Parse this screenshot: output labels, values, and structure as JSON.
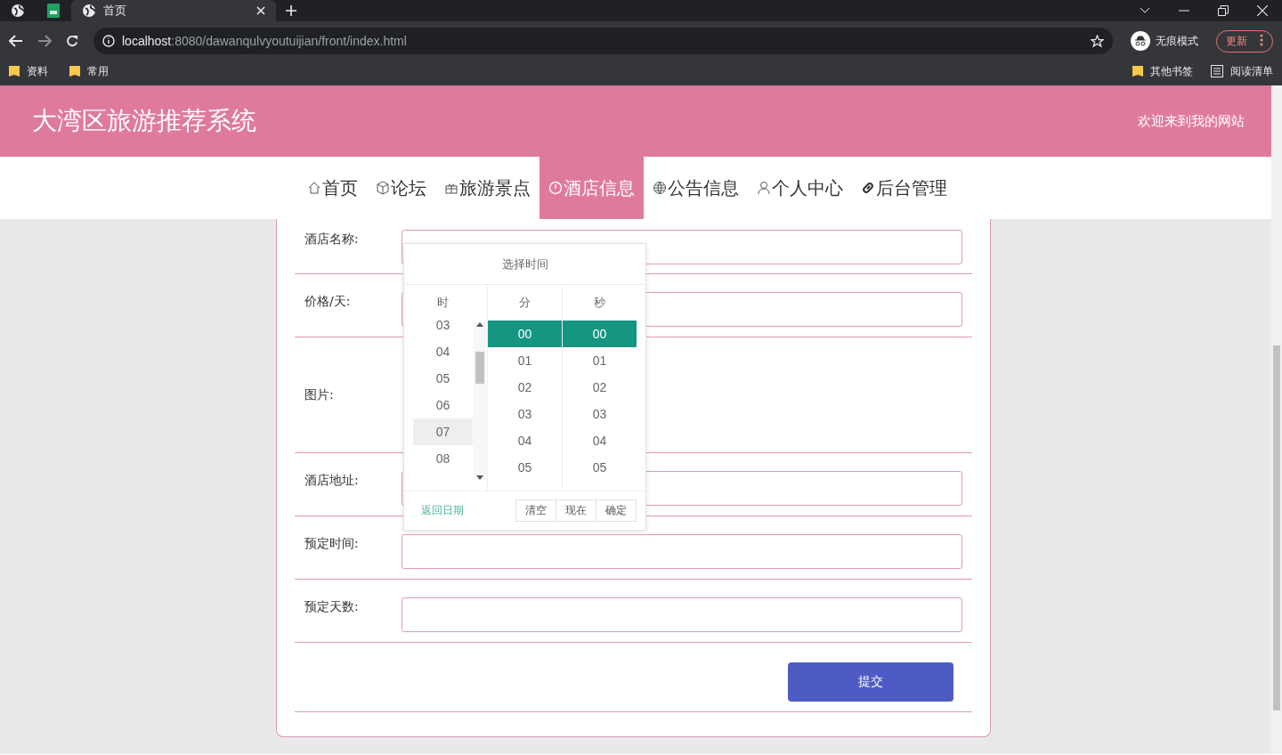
{
  "browser": {
    "tabs": [
      {
        "title": "首页",
        "selected": true
      }
    ],
    "address": {
      "host": "localhost",
      "path": ":8080/dawanqulvyoutuijian/front/index.html"
    },
    "profile": "无痕模式",
    "update_button": "更新",
    "bookmarks": [
      "资料",
      "常用"
    ],
    "other_bookmarks": "其他书签",
    "reading_list": "阅读清单"
  },
  "site": {
    "title": "大湾区旅游推荐系统",
    "welcome": "欢迎来到我的网站"
  },
  "nav": [
    {
      "label": "首页",
      "selected": false
    },
    {
      "label": "论坛",
      "selected": false
    },
    {
      "label": "旅游景点",
      "selected": false
    },
    {
      "label": "酒店信息",
      "selected": true
    },
    {
      "label": "公告信息",
      "selected": false
    },
    {
      "label": "个人中心",
      "selected": false
    },
    {
      "label": "后台管理",
      "selected": false
    }
  ],
  "form": {
    "fields": [
      {
        "label": "酒店名称:",
        "kind": "input"
      },
      {
        "label": "价格/天:",
        "kind": "input"
      },
      {
        "label": "图片:",
        "kind": "image"
      },
      {
        "label": "酒店地址:",
        "kind": "input"
      },
      {
        "label": "预定时间:",
        "kind": "input"
      },
      {
        "label": "预定天数:",
        "kind": "input"
      }
    ],
    "submit": "提交"
  },
  "time_picker": {
    "title": "选择时间",
    "columns": [
      {
        "header": "时",
        "items": [
          {
            "text": "03",
            "selected": false,
            "hovered": false
          },
          {
            "text": "04",
            "selected": false,
            "hovered": false
          },
          {
            "text": "05",
            "selected": false,
            "hovered": false
          },
          {
            "text": "06",
            "selected": false,
            "hovered": false
          },
          {
            "text": "07",
            "selected": false,
            "hovered": true
          },
          {
            "text": "08",
            "selected": false,
            "hovered": false
          }
        ]
      },
      {
        "header": "分",
        "items": [
          {
            "text": "00",
            "selected": true,
            "hovered": false
          },
          {
            "text": "01",
            "selected": false,
            "hovered": false
          },
          {
            "text": "02",
            "selected": false,
            "hovered": false
          },
          {
            "text": "03",
            "selected": false,
            "hovered": false
          },
          {
            "text": "04",
            "selected": false,
            "hovered": false
          },
          {
            "text": "05",
            "selected": false,
            "hovered": false
          }
        ]
      },
      {
        "header": "秒",
        "items": [
          {
            "text": "00",
            "selected": true,
            "hovered": false
          },
          {
            "text": "01",
            "selected": false,
            "hovered": false
          },
          {
            "text": "02",
            "selected": false,
            "hovered": false
          },
          {
            "text": "03",
            "selected": false,
            "hovered": false
          },
          {
            "text": "04",
            "selected": false,
            "hovered": false
          },
          {
            "text": "05",
            "selected": false,
            "hovered": false
          }
        ]
      }
    ],
    "back_link": "返回日期",
    "buttons": [
      "清空",
      "现在",
      "确定"
    ]
  }
}
